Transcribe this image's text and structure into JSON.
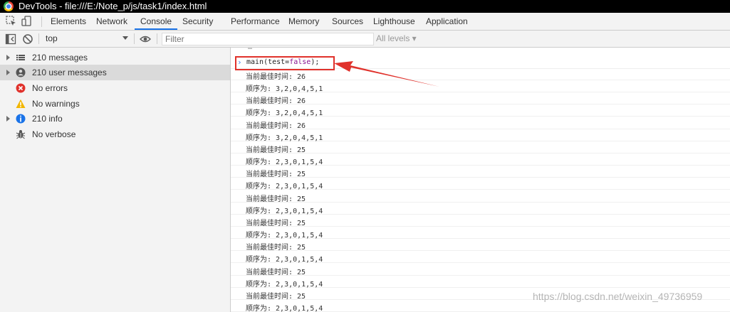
{
  "window": {
    "title": "DevTools - file:///E:/Note_p/js/task1/index.html"
  },
  "tabs": [
    {
      "label": "Elements",
      "active": false
    },
    {
      "label": "Network",
      "active": false
    },
    {
      "label": "Console",
      "active": true
    },
    {
      "label": "Security",
      "active": false
    },
    {
      "label": "Performance",
      "active": false
    },
    {
      "label": "Memory",
      "active": false
    },
    {
      "label": "Sources",
      "active": false
    },
    {
      "label": "Lighthouse",
      "active": false
    },
    {
      "label": "Application",
      "active": false
    }
  ],
  "toolbar": {
    "context": "top",
    "filter_placeholder": "Filter",
    "levels": "All levels ▾"
  },
  "sidebar": {
    "items": [
      {
        "label": "210 messages",
        "icon": "list-icon",
        "expandable": true,
        "selected": false
      },
      {
        "label": "210 user messages",
        "icon": "user-icon",
        "expandable": true,
        "selected": true
      },
      {
        "label": "No errors",
        "icon": "error-icon",
        "expandable": false,
        "selected": false
      },
      {
        "label": "No warnings",
        "icon": "warning-icon",
        "expandable": false,
        "selected": false
      },
      {
        "label": "210 info",
        "icon": "info-icon",
        "expandable": true,
        "selected": false
      },
      {
        "label": "No verbose",
        "icon": "bug-icon",
        "expandable": false,
        "selected": false
      }
    ]
  },
  "console": {
    "ellipsis": "…",
    "prompt": "›",
    "command": {
      "prefix": "main(test=",
      "keyword": "false",
      "suffix": ");"
    },
    "lines": [
      "当前最佳时间: 26",
      "顺序为: 3,2,0,4,5,1",
      "当前最佳时间: 26",
      "顺序为: 3,2,0,4,5,1",
      "当前最佳时间: 26",
      "顺序为: 3,2,0,4,5,1",
      "当前最佳时间: 25",
      "顺序为: 2,3,0,1,5,4",
      "当前最佳时间: 25",
      "顺序为: 2,3,0,1,5,4",
      "当前最佳时间: 25",
      "顺序为: 2,3,0,1,5,4",
      "当前最佳时间: 25",
      "顺序为: 2,3,0,1,5,4",
      "当前最佳时间: 25",
      "顺序为: 2,3,0,1,5,4",
      "当前最佳时间: 25",
      "顺序为: 2,3,0,1,5,4",
      "当前最佳时间: 25",
      "顺序为: 2,3,0,1,5,4"
    ]
  },
  "watermark": "https://blog.csdn.net/weixin_49736959",
  "colors": {
    "accent": "#1a73e8",
    "annotation": "#e0312b",
    "keyword": "#881391"
  }
}
